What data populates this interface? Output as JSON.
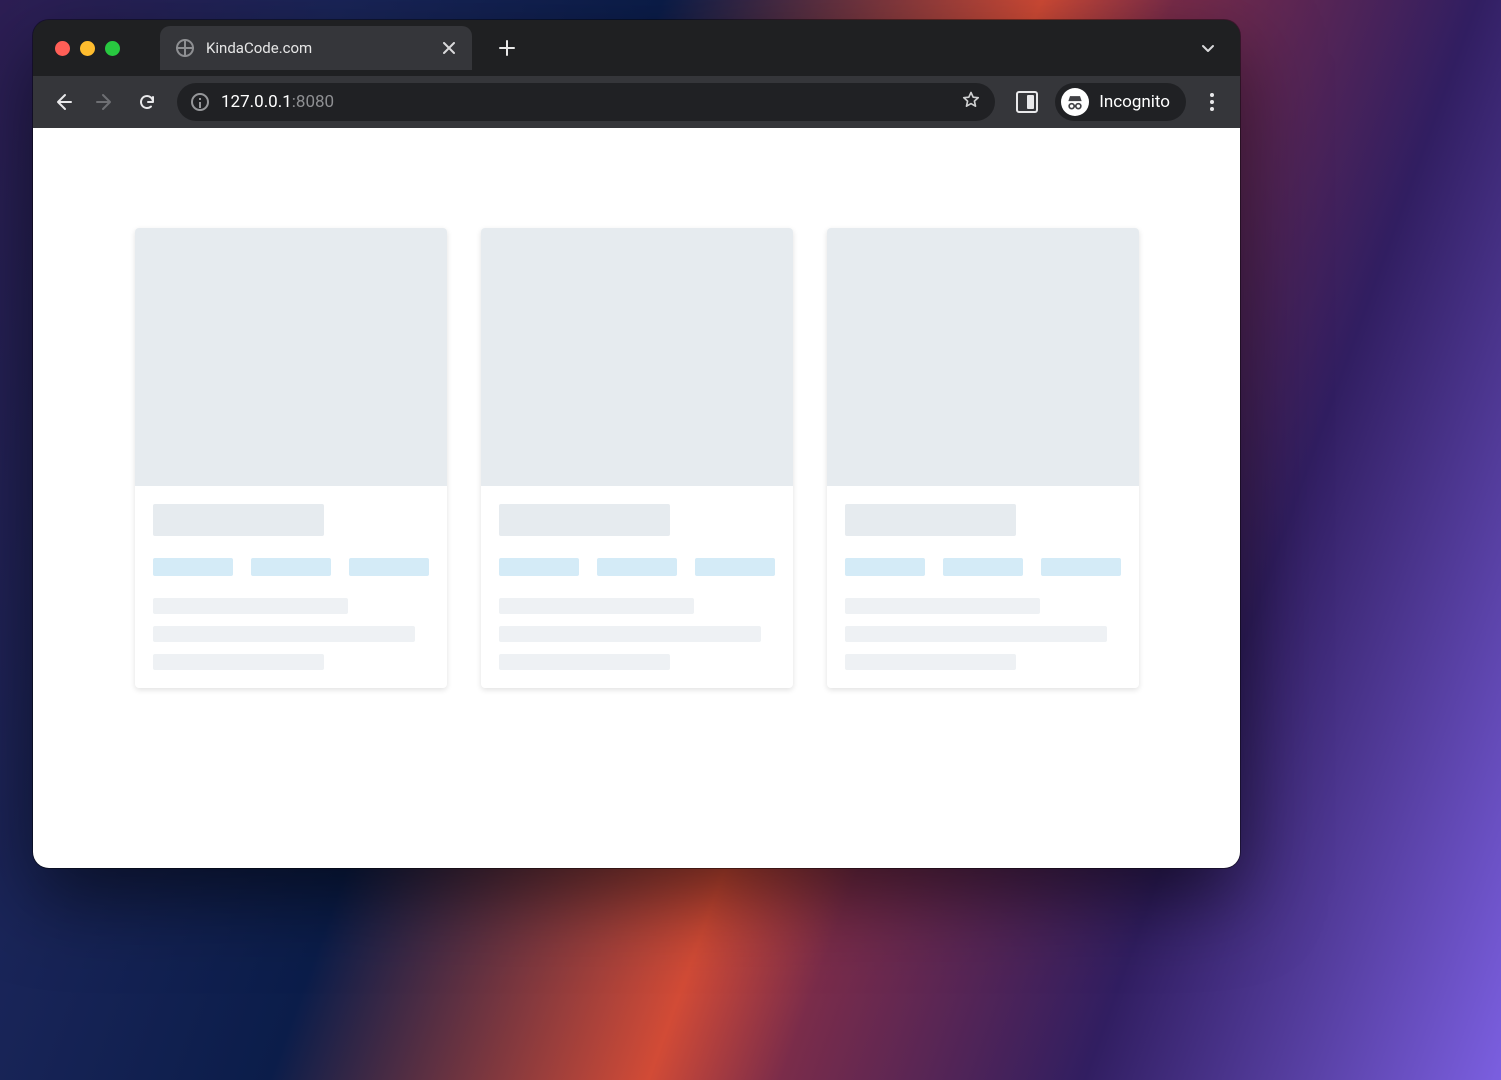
{
  "browser": {
    "tab_title": "KindaCode.com",
    "url_host": "127.0.0.1",
    "url_port": ":8080",
    "incognito_label": "Incognito"
  },
  "page": {
    "card_count": 3
  },
  "colors": {
    "skeleton_gray": "#e6ebef",
    "skeleton_tag": "#d4ebf7",
    "skeleton_line": "#eef1f4"
  }
}
